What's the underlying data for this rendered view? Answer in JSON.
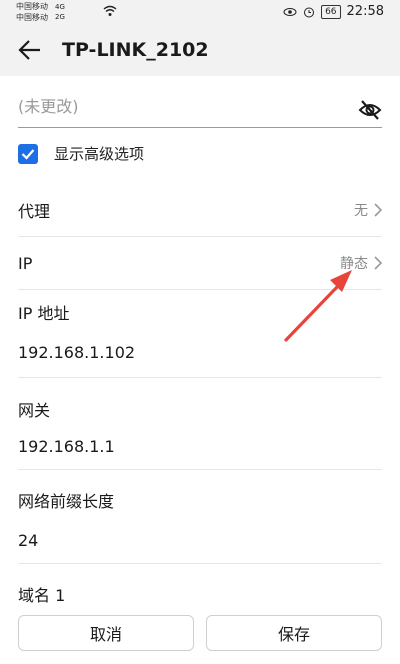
{
  "status_bar": {
    "carrier_1": "中国移动",
    "carrier_2": "中国移动",
    "net_1": "4G",
    "net_2": "2G",
    "battery": "66",
    "time": "22:58"
  },
  "header": {
    "title": "TP-LINK_2102"
  },
  "password": {
    "placeholder": "(未更改)"
  },
  "advanced": {
    "label": "显示高级选项",
    "checked": true
  },
  "proxy": {
    "label": "代理",
    "value": "无"
  },
  "ip": {
    "label": "IP",
    "value": "静态"
  },
  "ip_address": {
    "label": "IP 地址",
    "value": "192.168.1.102"
  },
  "gateway": {
    "label": "网关",
    "value": "192.168.1.1"
  },
  "prefix": {
    "label": "网络前缀长度",
    "value": "24"
  },
  "dns1": {
    "label": "域名 1"
  },
  "buttons": {
    "cancel": "取消",
    "save": "保存"
  },
  "colors": {
    "accent": "#1e6fe6",
    "annotation": "#e8443a"
  }
}
